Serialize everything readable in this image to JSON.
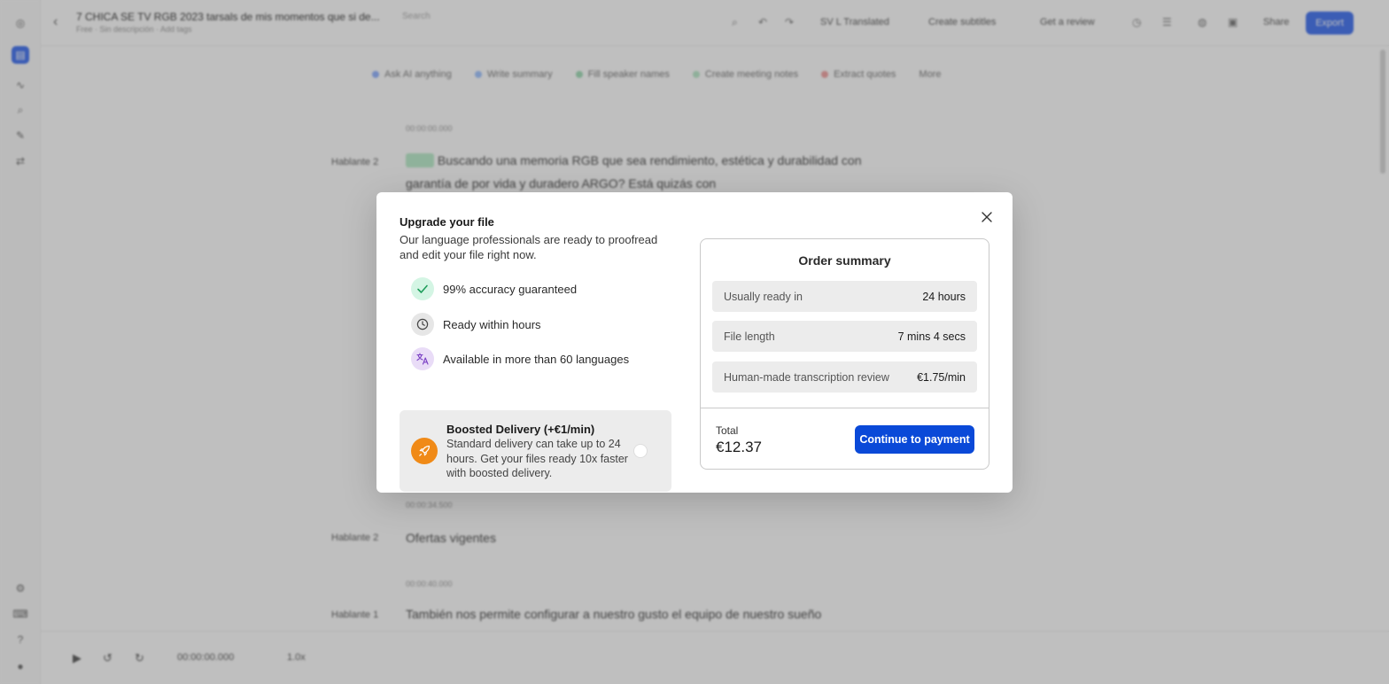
{
  "background": {
    "doc_title": "7 CHICA SE TV RGB 2023 tarsals de mis momentos que si de...",
    "doc_meta": "Free · Sin descripción · Add tags",
    "search": "Search",
    "toolbar": {
      "language": "SV L Translated",
      "create_subtitles": "Create subtitles",
      "get_review": "Get a review",
      "share": "Share",
      "export": "Export"
    },
    "chips": [
      "Ask AI anything",
      "Write summary",
      "Fill speaker names",
      "Create meeting notes",
      "Extract quotes",
      "More"
    ],
    "segments": [
      {
        "time": "00:00:00.000",
        "speaker": "Hablante 2",
        "text": "Buscando una memoria RGB que sea rendimiento, estética y durabilidad con garantía de por vida y duradero ARGO? Está quizás con"
      },
      {
        "time": "00:00:34.500",
        "speaker": "Hablante 2",
        "text": "Ofertas vigentes"
      },
      {
        "time": "00:00:40.000",
        "speaker": "Hablante 1",
        "text": "También nos permite configurar a nuestro gusto el equipo de nuestro sueño"
      }
    ],
    "player_time": "00:00:00.000",
    "player_speed": "1.0x"
  },
  "modal": {
    "title": "Upgrade your file",
    "subtitle": "Our language professionals are ready to proofread and edit your file right now.",
    "features": [
      {
        "icon": "check-icon",
        "label": "99% accuracy guaranteed",
        "color": "#d4f5e4"
      },
      {
        "icon": "clock-icon",
        "label": "Ready within hours",
        "color": "#e6e6e6"
      },
      {
        "icon": "translate-icon",
        "label": "Available in more than 60 languages",
        "color": "#e9dcf7"
      }
    ],
    "boost": {
      "title": "Boosted Delivery (+€1/min)",
      "description": "Standard delivery can take up to 24 hours. Get your files ready 10x faster with boosted delivery.",
      "enabled": false,
      "accent": "#f08a17"
    },
    "summary": {
      "title": "Order summary",
      "rows": [
        {
          "key": "Usually ready in",
          "value": "24 hours"
        },
        {
          "key": "File length",
          "value": "7 mins 4 secs"
        },
        {
          "key": "Human-made transcription review",
          "value": "€1.75/min"
        }
      ],
      "total_label": "Total",
      "total_value": "€12.37",
      "pay_button": "Continue to payment",
      "accent": "#0a49d8"
    }
  }
}
